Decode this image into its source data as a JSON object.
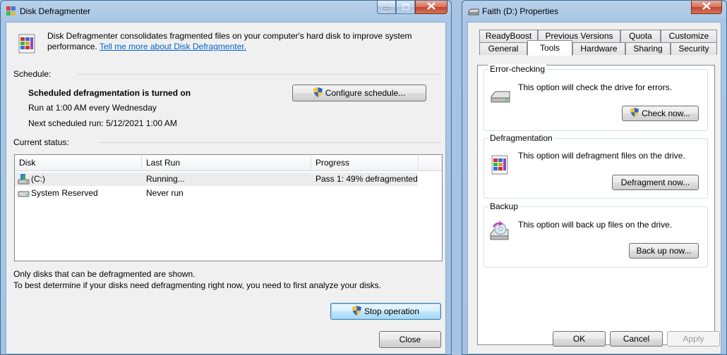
{
  "defrag": {
    "title": "Disk Defragmenter",
    "description_line1": "Disk Defragmenter consolidates fragmented files on your computer's hard disk to improve system",
    "description_line2": "performance.",
    "learn_more_link": "Tell me more about Disk Defragmenter.",
    "schedule_label": "Schedule:",
    "schedule_status": "Scheduled defragmentation is turned on",
    "run_at": "Run at 1:00 AM every Wednesday",
    "next_run": "Next scheduled run: 5/12/2021 1:00 AM",
    "configure_button": "Configure schedule...",
    "current_status_label": "Current status:",
    "columns": [
      "Disk",
      "Last Run",
      "Progress"
    ],
    "rows": [
      {
        "disk": "(C:)",
        "last_run": "Running...",
        "progress": "Pass 1: 49% defragmented"
      },
      {
        "disk": "System Reserved",
        "last_run": "Never run",
        "progress": ""
      }
    ],
    "note_line1": "Only disks that can be defragmented are shown.",
    "note_line2": "To best determine if your disks need defragmenting right now, you need to first analyze your disks.",
    "stop_button": "Stop operation",
    "close_button": "Close"
  },
  "properties": {
    "title": "Faith (D:) Properties",
    "tabs_top": [
      "ReadyBoost",
      "Previous Versions",
      "Quota",
      "Customize"
    ],
    "tabs_bottom": [
      "General",
      "Tools",
      "Hardware",
      "Sharing",
      "Security"
    ],
    "active_tab": "Tools",
    "error_checking": {
      "title": "Error-checking",
      "text": "This option will check the drive for errors.",
      "button": "Check now..."
    },
    "defragmentation": {
      "title": "Defragmentation",
      "text": "This option will defragment files on the drive.",
      "button": "Defragment now..."
    },
    "backup": {
      "title": "Backup",
      "text": "This option will back up files on the drive.",
      "button": "Back up now..."
    },
    "ok_button": "OK",
    "cancel_button": "Cancel",
    "apply_button": "Apply"
  },
  "icons": {
    "app_icon": "defragmenter-icon",
    "shield": "uac-shield-icon",
    "drive": "hard-drive-icon",
    "backup": "backup-icon"
  }
}
